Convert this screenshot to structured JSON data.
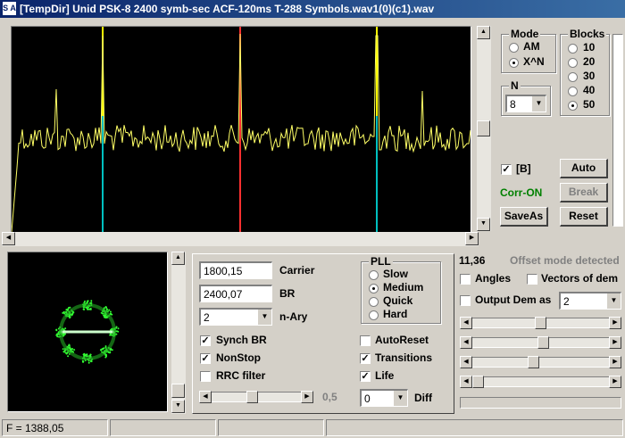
{
  "window": {
    "title": "[TempDir] Unid PSK-8 2400 symb-sec ACF-120ms T-288 Symbols.wav1(0)(c1).wav",
    "icon_text": "S A"
  },
  "mode_group": {
    "title": "Mode",
    "options": [
      "AM",
      "X^N"
    ],
    "selected": "X^N"
  },
  "blocks_group": {
    "title": "Blocks",
    "options": [
      "10",
      "20",
      "30",
      "40",
      "50"
    ],
    "selected": "50"
  },
  "n_group": {
    "title": "N",
    "value": "8"
  },
  "b_checkbox": {
    "label": "[B]",
    "checked": true
  },
  "corr_status": {
    "text": "Corr-ON",
    "color": "#008000"
  },
  "buttons": {
    "auto": "Auto",
    "break": "Break",
    "save_as": "SaveAs",
    "reset": "Reset"
  },
  "controls": {
    "carrier_value": "1800,15",
    "carrier_label": "Carrier",
    "br_value": "2400,07",
    "br_label": "BR",
    "nary_value": "2",
    "nary_label": "n-Ary",
    "synch_br": {
      "label": "Synch BR",
      "checked": true
    },
    "nonstop": {
      "label": "NonStop",
      "checked": true
    },
    "rrc_filter": {
      "label": "RRC filter",
      "checked": false
    },
    "slider_value": "0,5",
    "slider_level": 0.45,
    "diff_value": "0",
    "diff_label": "Diff"
  },
  "pll_group": {
    "title": "PLL",
    "options": [
      "Slow",
      "Medium",
      "Quick",
      "Hard"
    ],
    "selected": "Medium"
  },
  "right_checks": {
    "autoreset": {
      "label": "AutoReset",
      "checked": false
    },
    "transitions": {
      "label": "Transitions",
      "checked": true
    },
    "life": {
      "label": "Life",
      "checked": true
    }
  },
  "offset_panel": {
    "value": "11,36",
    "message": "Offset mode detected",
    "angles": {
      "label": "Angles",
      "checked": false
    },
    "vectors": {
      "label": "Vectors of dem",
      "checked": false
    },
    "output_dem": {
      "label": "Output Dem as",
      "checked": false
    },
    "output_value": "2",
    "slider_levels": [
      0.5,
      0.52,
      0.44,
      0.0
    ]
  },
  "status_bar": {
    "freq": "F = 1388,05"
  },
  "colors": {
    "waveform": "#ffff66",
    "marker_yellow": "#ffff00",
    "marker_cyan": "#00c0c0",
    "marker_red": "#ff3030",
    "constellation": "#33ff33"
  }
}
